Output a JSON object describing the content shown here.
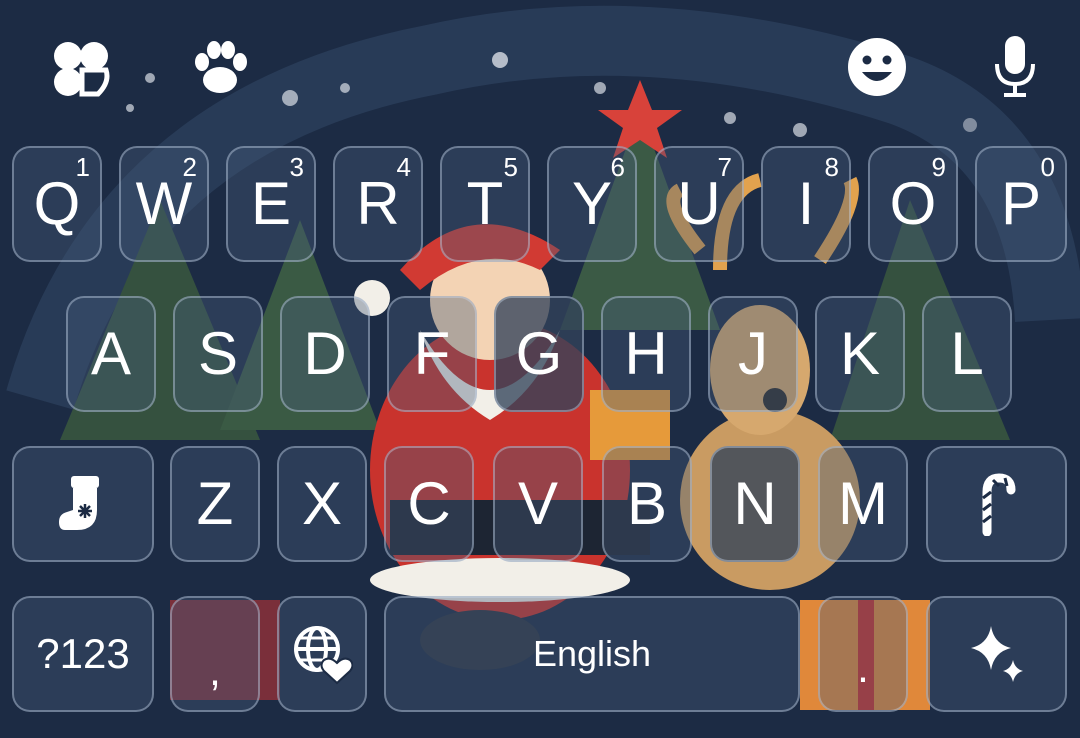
{
  "toolbar": {
    "left_icons": [
      "theme-clover-icon",
      "paw-icon"
    ],
    "right_icons": [
      "emoji-icon",
      "microphone-icon"
    ]
  },
  "rows": [
    [
      {
        "label": "Q",
        "hint": "1"
      },
      {
        "label": "W",
        "hint": "2"
      },
      {
        "label": "E",
        "hint": "3"
      },
      {
        "label": "R",
        "hint": "4"
      },
      {
        "label": "T",
        "hint": "5"
      },
      {
        "label": "Y",
        "hint": "6"
      },
      {
        "label": "U",
        "hint": "7"
      },
      {
        "label": "I",
        "hint": "8"
      },
      {
        "label": "O",
        "hint": "9"
      },
      {
        "label": "P",
        "hint": "0"
      }
    ],
    [
      {
        "label": "A"
      },
      {
        "label": "S"
      },
      {
        "label": "D"
      },
      {
        "label": "F"
      },
      {
        "label": "G"
      },
      {
        "label": "H"
      },
      {
        "label": "J"
      },
      {
        "label": "K"
      },
      {
        "label": "L"
      }
    ],
    [
      {
        "icon": "christmas-stocking-icon"
      },
      {
        "label": "Z"
      },
      {
        "label": "X"
      },
      {
        "label": "C"
      },
      {
        "label": "V"
      },
      {
        "label": "B"
      },
      {
        "label": "N"
      },
      {
        "label": "M"
      },
      {
        "icon": "candy-cane-icon"
      }
    ]
  ],
  "bottom": {
    "symbols_label": "?123",
    "comma_label": ",",
    "globe_icon": "globe-heart-icon",
    "space_label": "English",
    "period_label": ".",
    "sparkle_icon": "sparkle-icon"
  }
}
